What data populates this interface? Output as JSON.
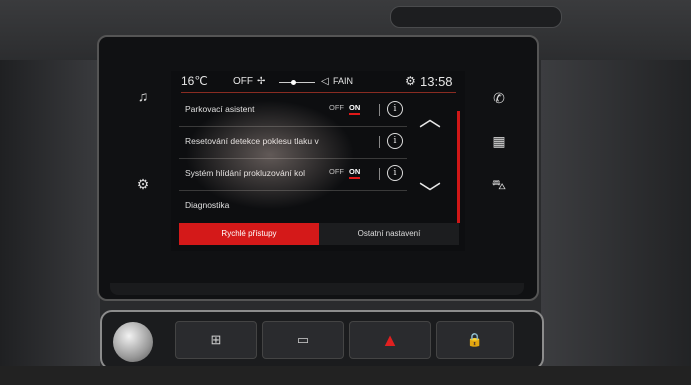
{
  "status_bar": {
    "temperature": "16℃",
    "fan_state": "OFF",
    "fan_icon": "fan-icon",
    "volume_icon": "speaker-icon",
    "volume_label": "FAIN",
    "settings_icon": "gear-icon",
    "time": "13:58"
  },
  "hard_keys": {
    "left": [
      {
        "icon": "music-note-icon",
        "glyph": "♫"
      },
      {
        "icon": "fan-person-icon",
        "glyph": "⚙"
      }
    ],
    "right": [
      {
        "icon": "phone-icon",
        "glyph": "✆"
      },
      {
        "icon": "apps-grid-icon",
        "glyph": "▦"
      },
      {
        "icon": "car-icon",
        "glyph": "⛍"
      }
    ]
  },
  "settings": [
    {
      "label": "Parkovací asistent",
      "off": "OFF",
      "on": "ON",
      "info": "i"
    },
    {
      "label": "Resetování detekce poklesu tlaku v",
      "info": "i"
    },
    {
      "label": "Systém hlídání prokluzování kol",
      "off": "OFF",
      "on": "ON",
      "info": "i"
    },
    {
      "label": "Diagnostika"
    }
  ],
  "scroll": {
    "up": "︿",
    "down": "﹀"
  },
  "tabs": {
    "active": "Rychlé přístupy",
    "inactive": "Ostatní nastavení"
  },
  "panel_buttons": [
    {
      "icon": "rear-defrost-icon",
      "glyph": "⊞"
    },
    {
      "icon": "front-defrost-icon",
      "glyph": "▭"
    },
    {
      "icon": "hazard-warning-icon",
      "glyph": "▲"
    },
    {
      "icon": "door-lock-icon",
      "glyph": "🔒"
    }
  ],
  "colors": {
    "accent": "#d41919"
  }
}
